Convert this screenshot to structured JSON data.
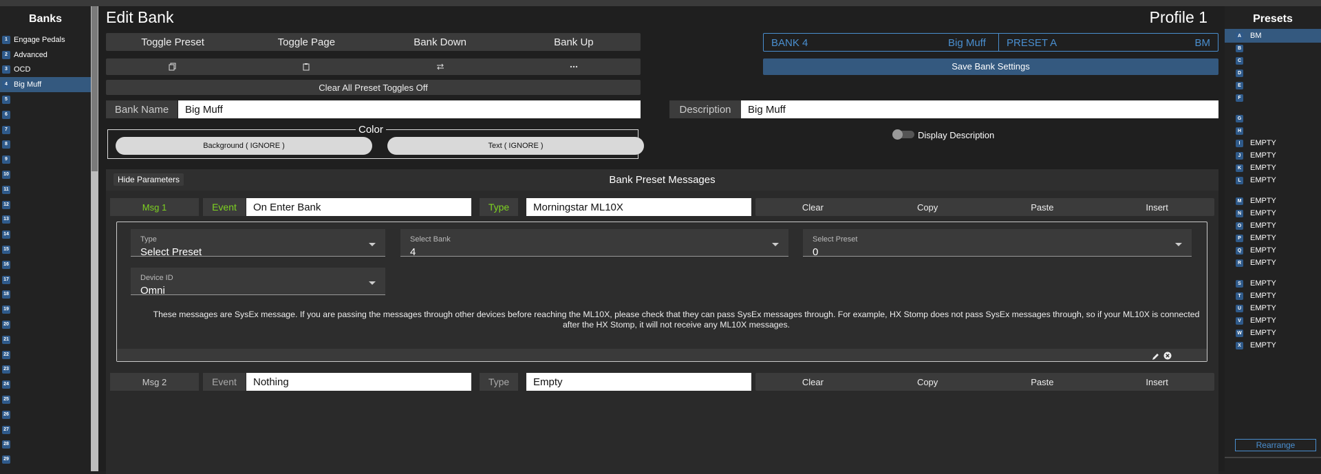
{
  "left_panel": {
    "title": "Banks",
    "banks": [
      {
        "num": "1",
        "name": "Engage Pedals"
      },
      {
        "num": "2",
        "name": "Advanced"
      },
      {
        "num": "3",
        "name": "OCD"
      },
      {
        "num": "4",
        "name": "Big Muff"
      },
      {
        "num": "5",
        "name": ""
      },
      {
        "num": "6",
        "name": ""
      },
      {
        "num": "7",
        "name": ""
      },
      {
        "num": "8",
        "name": ""
      },
      {
        "num": "9",
        "name": ""
      },
      {
        "num": "10",
        "name": ""
      },
      {
        "num": "11",
        "name": ""
      },
      {
        "num": "12",
        "name": ""
      },
      {
        "num": "13",
        "name": ""
      },
      {
        "num": "14",
        "name": ""
      },
      {
        "num": "15",
        "name": ""
      },
      {
        "num": "16",
        "name": ""
      },
      {
        "num": "17",
        "name": ""
      },
      {
        "num": "18",
        "name": ""
      },
      {
        "num": "19",
        "name": ""
      },
      {
        "num": "20",
        "name": ""
      },
      {
        "num": "21",
        "name": ""
      },
      {
        "num": "22",
        "name": ""
      },
      {
        "num": "23",
        "name": ""
      },
      {
        "num": "24",
        "name": ""
      },
      {
        "num": "25",
        "name": ""
      },
      {
        "num": "26",
        "name": ""
      },
      {
        "num": "27",
        "name": ""
      },
      {
        "num": "28",
        "name": ""
      },
      {
        "num": "29",
        "name": ""
      }
    ],
    "selected_index": 3
  },
  "header": {
    "title": "Edit Bank",
    "profile": "Profile 1"
  },
  "toolbar": {
    "toggle_preset": "Toggle Preset",
    "toggle_page": "Toggle Page",
    "bank_down": "Bank Down",
    "bank_up": "Bank Up",
    "icons": [
      "copy-icon",
      "paste-icon",
      "swap-icon",
      "more-icon"
    ],
    "clear_toggles": "Clear All Preset Toggles Off"
  },
  "status": {
    "bank": "BANK 4",
    "bank_name": "Big Muff",
    "preset": "PRESET A",
    "preset_short": "BM",
    "save": "Save Bank Settings"
  },
  "bank_form": {
    "name_label": "Bank Name",
    "name_value": "Big Muff",
    "desc_label": "Description",
    "desc_value": "Big Muff",
    "color_legend": "Color",
    "bg_button": "Background ( IGNORE )",
    "text_button": "Text ( IGNORE )",
    "display_desc": "Display Description"
  },
  "messages": {
    "hide_params": "Hide Parameters",
    "title": "Bank Preset Messages",
    "msg1": {
      "label": "Msg 1",
      "event_label": "Event",
      "event_value": "On Enter Bank",
      "type_label": "Type",
      "type_value": "Morningstar ML10X",
      "actions": [
        "Clear",
        "Copy",
        "Paste",
        "Insert"
      ],
      "params": {
        "type_label": "Type",
        "type_value": "Select Preset",
        "bank_label": "Select Bank",
        "bank_value": "4",
        "preset_label": "Select Preset",
        "preset_value": "0",
        "device_label": "Device ID",
        "device_value": "Omni"
      },
      "note": "These messages are SysEx message. If you are passing the messages through other devices before reaching the ML10X, please check that they can pass SysEx messages through. For example, HX Stomp does not pass SysEx messages through, so if your ML10X is connected after the HX Stomp, it will not receive any ML10X messages."
    },
    "msg2": {
      "label": "Msg 2",
      "event_label": "Event",
      "event_value": "Nothing",
      "type_label": "Type",
      "type_value": "Empty",
      "actions": [
        "Clear",
        "Copy",
        "Paste",
        "Insert"
      ]
    }
  },
  "right_panel": {
    "title": "Presets",
    "presets": [
      {
        "letter": "A",
        "name": "BM"
      },
      {
        "letter": "B",
        "name": ""
      },
      {
        "letter": "C",
        "name": ""
      },
      {
        "letter": "D",
        "name": ""
      },
      {
        "letter": "E",
        "name": ""
      },
      {
        "letter": "F",
        "name": ""
      },
      {
        "letter": "G",
        "name": ""
      },
      {
        "letter": "H",
        "name": ""
      },
      {
        "letter": "I",
        "name": "EMPTY"
      },
      {
        "letter": "J",
        "name": "EMPTY"
      },
      {
        "letter": "K",
        "name": "EMPTY"
      },
      {
        "letter": "L",
        "name": "EMPTY"
      },
      {
        "letter": "M",
        "name": "EMPTY"
      },
      {
        "letter": "N",
        "name": "EMPTY"
      },
      {
        "letter": "O",
        "name": "EMPTY"
      },
      {
        "letter": "P",
        "name": "EMPTY"
      },
      {
        "letter": "Q",
        "name": "EMPTY"
      },
      {
        "letter": "R",
        "name": "EMPTY"
      },
      {
        "letter": "S",
        "name": "EMPTY"
      },
      {
        "letter": "T",
        "name": "EMPTY"
      },
      {
        "letter": "U",
        "name": "EMPTY"
      },
      {
        "letter": "V",
        "name": "EMPTY"
      },
      {
        "letter": "W",
        "name": "EMPTY"
      },
      {
        "letter": "X",
        "name": "EMPTY"
      }
    ],
    "rearrange": "Rearrange"
  },
  "colors": {
    "accent": "#4a8fd0",
    "selected": "#34597f",
    "green": "#7ed321",
    "save_button": "#34597f"
  }
}
